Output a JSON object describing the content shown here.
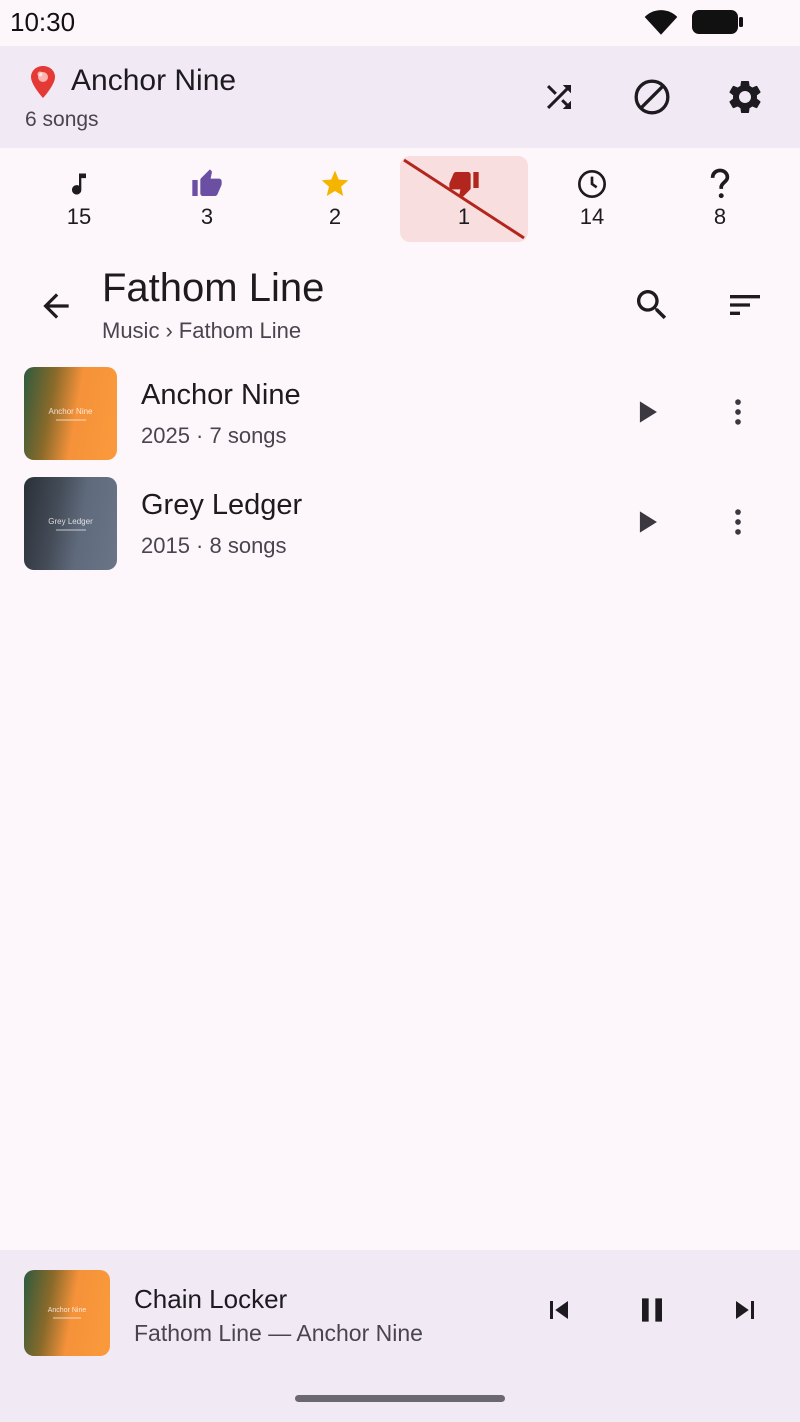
{
  "status_bar": {
    "time": "10:30"
  },
  "header": {
    "title": "Anchor Nine",
    "subtitle": "6 songs",
    "icons": [
      "pin-icon",
      "shuffle-icon",
      "block-icon",
      "gear-icon"
    ]
  },
  "filters": [
    {
      "icon": "music-note-icon",
      "count": "15",
      "color": "#1d1b20",
      "active": false
    },
    {
      "icon": "thumbs-up-icon",
      "count": "3",
      "color": "#6a4fa3",
      "active": false
    },
    {
      "icon": "star-icon",
      "count": "2",
      "color": "#f4b400",
      "active": false
    },
    {
      "icon": "thumbs-down-icon",
      "count": "1",
      "color": "#b3261e",
      "active": true
    },
    {
      "icon": "clock-icon",
      "count": "14",
      "color": "#1d1b20",
      "active": false
    },
    {
      "icon": "question-icon",
      "count": "8",
      "color": "#1d1b20",
      "active": false
    }
  ],
  "page": {
    "title": "Fathom Line",
    "breadcrumb": {
      "root": "Music",
      "separator": "›",
      "current": "Fathom Line"
    }
  },
  "albums": [
    {
      "name": "Anchor Nine",
      "meta": "2025 · 7 songs",
      "art_title": "Anchor Nine"
    },
    {
      "name": "Grey Ledger",
      "meta": "2015 · 8 songs",
      "art_title": "Grey Ledger"
    }
  ],
  "now_playing": {
    "title": "Chain Locker",
    "subtitle": "Fathom Line — Anchor Nine",
    "art_title": "Anchor Nine"
  },
  "colors": {
    "background": "#fdf7fc",
    "header_bg": "#f1eaf5",
    "active_filter_bg": "#f8dede",
    "accent_red": "#b3261e"
  }
}
